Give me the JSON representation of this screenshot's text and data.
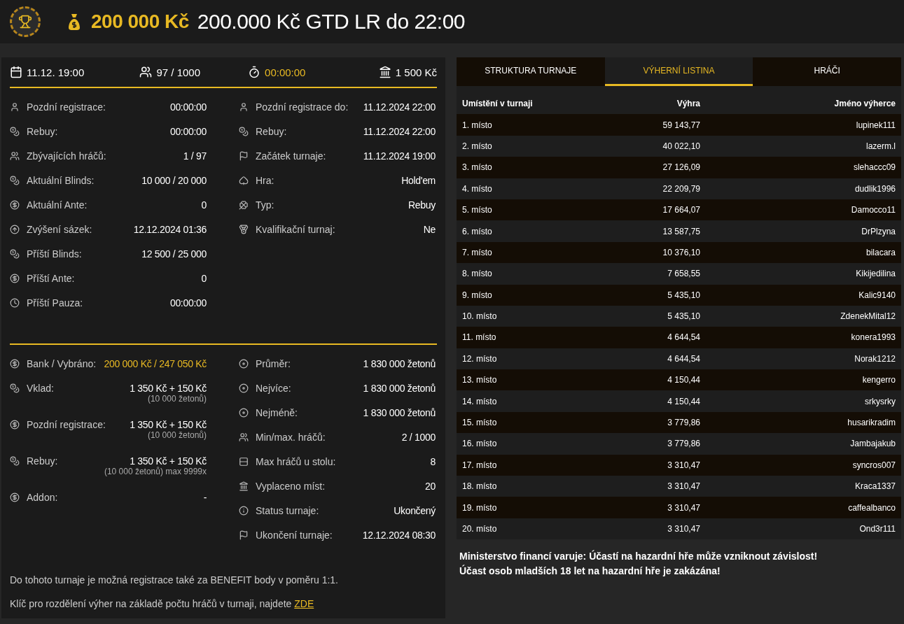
{
  "header": {
    "prize": "200 000 Kč",
    "title": "200.000 Kč GTD LR do 22:00"
  },
  "summary": [
    {
      "text": "11.12. 19:00",
      "highlighted": false
    },
    {
      "text": "97 / 1000",
      "highlighted": false
    },
    {
      "text": "00:00:00",
      "highlighted": true
    },
    {
      "text": "1 500 Kč",
      "highlighted": false
    }
  ],
  "status_left": [
    {
      "label": "Pozdní registrace:",
      "value": "00:00:00"
    },
    {
      "label": "Rebuy:",
      "value": "00:00:00"
    },
    {
      "label": "Zbývajících hráčů:",
      "value": "1 / 97"
    },
    {
      "label": "Aktuální Blinds:",
      "value": "10 000 / 20 000"
    },
    {
      "label": "Aktuální Ante:",
      "value": "0"
    },
    {
      "label": "Zvýšení sázek:",
      "value": "12.12.2024 01:36"
    },
    {
      "label": "Příští Blinds:",
      "value": "12 500 / 25 000"
    },
    {
      "label": "Příští Ante:",
      "value": "0"
    },
    {
      "label": "Příští Pauza:",
      "value": "00:00:00"
    }
  ],
  "status_right": [
    {
      "label": "Pozdní registrace do:",
      "value": "11.12.2024 22:00"
    },
    {
      "label": "Rebuy:",
      "value": "11.12.2024 22:00"
    },
    {
      "label": "Začátek turnaje:",
      "value": "11.12.2024 19:00"
    },
    {
      "label": "Hra:",
      "value": "Hold'em"
    },
    {
      "label": "Typ:",
      "value": "Rebuy"
    },
    {
      "label": "Kvalifikační turnaj:",
      "value": "Ne"
    }
  ],
  "money_left": [
    {
      "label": "Bank / Vybráno:",
      "value": "200 000 Kč / 247 050 Kč",
      "highlighted": true
    },
    {
      "label": "Vklad:",
      "value": "1 350 Kč + 150 Kč",
      "note": "(10 000 žetonů)",
      "highlighted": false
    },
    {
      "label": "Pozdní registrace:",
      "value": "1 350 Kč + 150 Kč",
      "note": "(10 000 žetonů)",
      "highlighted": false
    },
    {
      "label": "Rebuy:",
      "value": "1 350 Kč + 150 Kč",
      "note": "(10 000 žetonů) max 9999x",
      "highlighted": false
    },
    {
      "label": "Addon:",
      "value": "-",
      "highlighted": false
    }
  ],
  "money_right": [
    {
      "label": "Průměr:",
      "value": "1 830 000 žetonů"
    },
    {
      "label": "Nejvíce:",
      "value": "1 830 000 žetonů"
    },
    {
      "label": "Nejméně:",
      "value": "1 830 000 žetonů"
    },
    {
      "label": "Min/max. hráčů:",
      "value": "2 / 1000"
    },
    {
      "label": "Max hráčů u stolu:",
      "value": "8"
    },
    {
      "label": "Vyplaceno míst:",
      "value": "20"
    },
    {
      "label": "Status turnaje:",
      "value": "Ukončený"
    },
    {
      "label": "Ukončení turnaje:",
      "value": "12.12.2024 08:30"
    }
  ],
  "notes": [
    {
      "text": "Do tohoto turnaje je možná registrace také za BENEFIT body v poměru 1:1."
    },
    {
      "text": "Klíč pro rozdělení výher na základě počtu hráčů v turnaji, najdete ",
      "link": "ZDE"
    }
  ],
  "tabs": [
    {
      "label": "STRUKTURA TURNAJE",
      "selected": false
    },
    {
      "label": "VÝHERNÍ LISTINA",
      "selected": true
    },
    {
      "label": "HRÁČI",
      "selected": false
    }
  ],
  "table": {
    "columns": [
      "Umístění v turnaji",
      "Výhra",
      "Jméno výherce"
    ],
    "rows": [
      [
        "1. místo",
        "59 143,77",
        "lupinek111"
      ],
      [
        "2. místo",
        "40 022,10",
        "lazerm.l"
      ],
      [
        "3. místo",
        "27 126,09",
        "slehaccc09"
      ],
      [
        "4. místo",
        "22 209,79",
        "dudlik1996"
      ],
      [
        "5. místo",
        "17 664,07",
        "Damocco11"
      ],
      [
        "6. místo",
        "13 587,75",
        "DrPlzyna"
      ],
      [
        "7. místo",
        "10 376,10",
        "bilacara"
      ],
      [
        "8. místo",
        "7 658,55",
        "Kikijedilina"
      ],
      [
        "9. místo",
        "5 435,10",
        "Kalic9140"
      ],
      [
        "10. místo",
        "5 435,10",
        "ZdenekMital12"
      ],
      [
        "11. místo",
        "4 644,54",
        "konera1993"
      ],
      [
        "12. místo",
        "4 644,54",
        "Norak1212"
      ],
      [
        "13. místo",
        "4 150,44",
        "kengerro"
      ],
      [
        "14. místo",
        "4 150,44",
        "srkysrky"
      ],
      [
        "15. místo",
        "3 779,86",
        "husarikradim"
      ],
      [
        "16. místo",
        "3 779,86",
        "Jambajakub"
      ],
      [
        "17. místo",
        "3 310,47",
        "syncros007"
      ],
      [
        "18. místo",
        "3 310,47",
        "Kraca1337"
      ],
      [
        "19. místo",
        "3 310,47",
        "caffealbanco"
      ],
      [
        "20. místo",
        "3 310,47",
        "Ond3r111"
      ]
    ]
  },
  "warning": [
    "Ministerstvo financí varuje: Účastí na hazardní hře může vzniknout závislost!",
    "Účast osob mladších 18 let na hazardní hře je zakázána!"
  ]
}
